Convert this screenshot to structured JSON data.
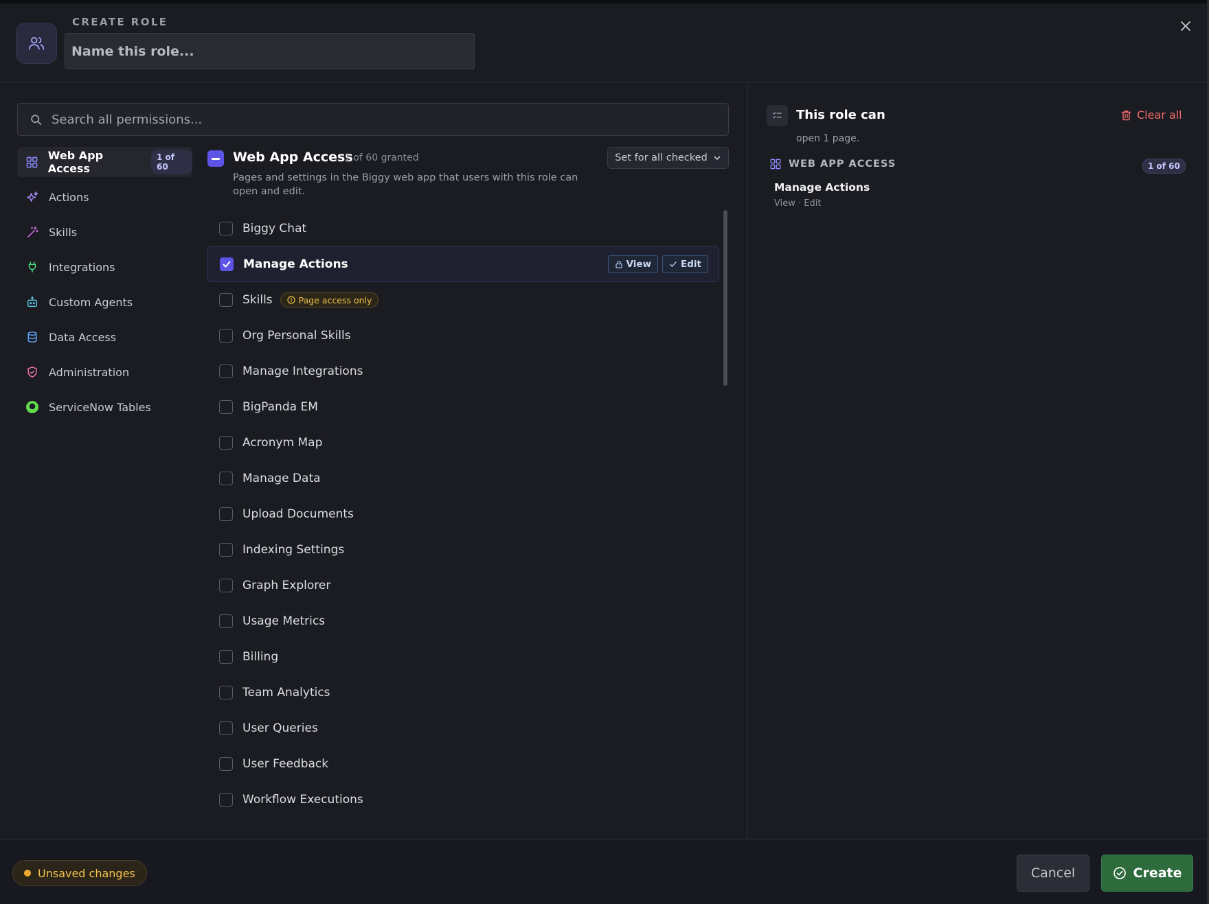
{
  "header": {
    "eyebrow": "CREATE ROLE",
    "name_placeholder": "Name this role..."
  },
  "search": {
    "placeholder": "Search all permissions..."
  },
  "nav": {
    "items": [
      {
        "label": "Web App Access",
        "badge": "1 of 60",
        "icon": "grid-icon",
        "color": "#8f8cff"
      },
      {
        "label": "Actions",
        "icon": "sparkles-icon",
        "color": "#a78bfa"
      },
      {
        "label": "Skills",
        "icon": "magic-wand-icon",
        "color": "#d46be8"
      },
      {
        "label": "Integrations",
        "icon": "plug-icon",
        "color": "#4ade80"
      },
      {
        "label": "Custom Agents",
        "icon": "robot-icon",
        "color": "#5fc8e8"
      },
      {
        "label": "Data Access",
        "icon": "database-icon",
        "color": "#60a5fa"
      },
      {
        "label": "Administration",
        "icon": "shield-icon",
        "color": "#f472b6"
      },
      {
        "label": "ServiceNow Tables",
        "icon": "servicenow-logo-icon",
        "color": "#62d84e"
      }
    ]
  },
  "section": {
    "title": "Web App Access",
    "count": "1 of 60 granted",
    "description": "Pages and settings in the Biggy web app that users with this role can open and edit.",
    "set_all_label": "Set for all checked"
  },
  "permissions": [
    {
      "label": "Biggy Chat",
      "checked": false
    },
    {
      "label": "Manage Actions",
      "checked": true,
      "view_label": "View",
      "edit_label": "Edit"
    },
    {
      "label": "Skills",
      "checked": false,
      "tag": "Page access only"
    },
    {
      "label": "Org Personal Skills",
      "checked": false
    },
    {
      "label": "Manage Integrations",
      "checked": false
    },
    {
      "label": "BigPanda EM",
      "checked": false
    },
    {
      "label": "Acronym Map",
      "checked": false
    },
    {
      "label": "Manage Data",
      "checked": false
    },
    {
      "label": "Upload Documents",
      "checked": false
    },
    {
      "label": "Indexing Settings",
      "checked": false
    },
    {
      "label": "Graph Explorer",
      "checked": false
    },
    {
      "label": "Usage Metrics",
      "checked": false
    },
    {
      "label": "Billing",
      "checked": false
    },
    {
      "label": "Team Analytics",
      "checked": false
    },
    {
      "label": "User Queries",
      "checked": false
    },
    {
      "label": "User Feedback",
      "checked": false
    },
    {
      "label": "Workflow Executions",
      "checked": false
    }
  ],
  "summary": {
    "title": "This role can",
    "subtitle": "open 1 page.",
    "clear_all": "Clear all",
    "group_title": "WEB APP ACCESS",
    "group_badge": "1 of 60",
    "item_name": "Manage Actions",
    "item_rights": "View · Edit"
  },
  "footer": {
    "unsaved": "Unsaved changes",
    "cancel": "Cancel",
    "create": "Create"
  },
  "colors": {
    "accent": "#5b54e6",
    "create_green": "#2d6a3c",
    "danger": "#ef6b6b",
    "warning": "#f3c34d"
  }
}
